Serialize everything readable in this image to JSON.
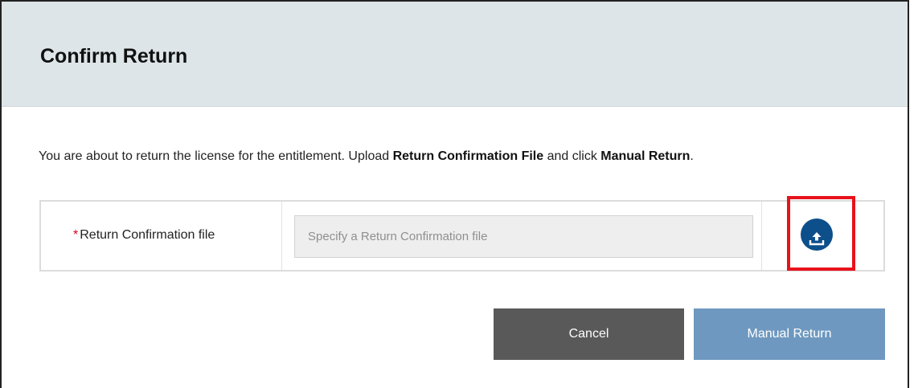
{
  "dialog": {
    "title": "Confirm Return",
    "intro": {
      "part1": "You are about to return the license for the entitlement. Upload ",
      "bold1": "Return Confirmation File",
      "part2": " and click ",
      "bold2": "Manual Return",
      "part3": "."
    },
    "file_field": {
      "required_marker": "*",
      "label": "Return Confirmation file",
      "value": "",
      "placeholder": "Specify a Return Confirmation file",
      "upload_icon": "upload-icon"
    },
    "buttons": {
      "cancel": "Cancel",
      "manual_return": "Manual Return"
    }
  },
  "colors": {
    "header_bg": "#dde5e8",
    "upload_button": "#0d4f8b",
    "highlight": "#e8121b",
    "cancel_button": "#595959",
    "manual_return_button": "#6e98bf",
    "required_marker": "#d0021b"
  }
}
